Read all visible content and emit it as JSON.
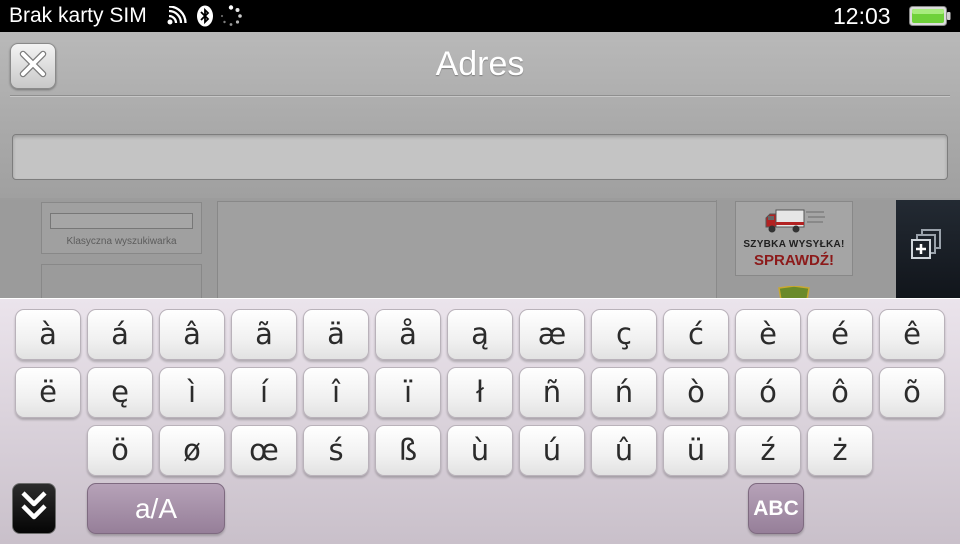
{
  "status_bar": {
    "carrier": "Brak karty SIM",
    "time": "12:03",
    "icons": [
      "wifi-icon",
      "bluetooth-icon",
      "busy-indicator-icon",
      "battery-icon"
    ],
    "battery_color": "#6fd13a"
  },
  "header": {
    "title": "Adres",
    "close_icon": "close-icon",
    "address_value": "",
    "address_placeholder": ""
  },
  "webpage": {
    "search_label": "Klasyczna wyszukiwarka",
    "banner_line1": "SZYBKA WYSYŁKA!",
    "banner_line2": "SPRAWDŹ!",
    "tabs_icon": "new-tab-icon"
  },
  "keyboard": {
    "rows": [
      [
        "à",
        "á",
        "â",
        "ã",
        "ä",
        "å",
        "ą",
        "æ",
        "ç",
        "ć",
        "è",
        "é",
        "ê"
      ],
      [
        "ë",
        "ę",
        "ì",
        "í",
        "î",
        "ï",
        "ł",
        "ñ",
        "ń",
        "ò",
        "ó",
        "ô",
        "õ"
      ],
      [
        "ö",
        "ø",
        "œ",
        "ś",
        "ß",
        "ù",
        "ú",
        "û",
        "ü",
        "ź",
        "ż"
      ]
    ],
    "shift_label": "a/A",
    "abc_label": "ABC",
    "hide_icon": "chevron-double-down-icon",
    "accent_color": "#9a839d"
  }
}
